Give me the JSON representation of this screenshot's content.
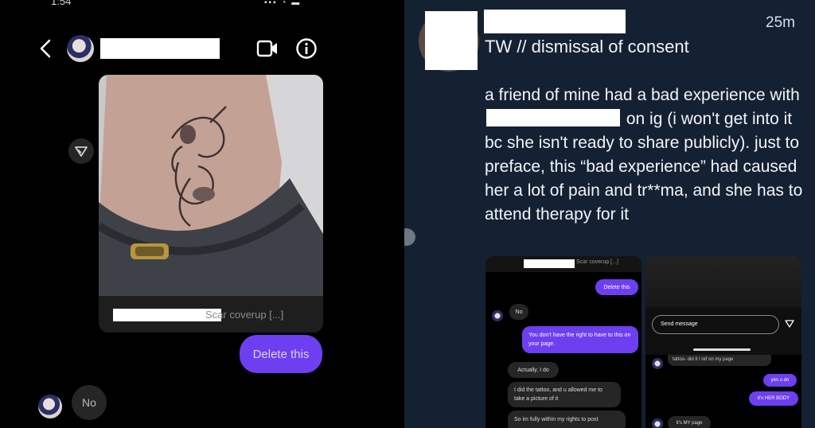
{
  "left_panel": {
    "status_time": "1:54",
    "status_icons": "▪▪▪ ◔ ▬",
    "photo_caption": "Scar coverup [...]",
    "outgoing_message": "Delete this",
    "incoming_message": "No"
  },
  "right_panel": {
    "time_ago": "25m",
    "title": "TW // dismissal of consent",
    "body_before": "a friend of mine had a bad experience with",
    "body_after": "on ig (i won't get into it bc she isn't ready to share publicly). just to preface, this “bad experience” had caused her a lot of pain and tr**ma, and she has to attend therapy for it",
    "screenshot_1": {
      "caption": "Scar coverup [...]",
      "delete": "Delete this",
      "no": "No",
      "right_msg": "You don't have the right to have to this on your page.",
      "actually": "Actually, I do",
      "did_tattoo": "I did the tattoo, and u allowed me to take a picture of it",
      "rights": "So im fully within my rights to post"
    },
    "screenshot_2": {
      "send_placeholder": "Send message",
      "top_msg": "tattoo- did it I ref on my page",
      "yes_u_do": "yes u do",
      "her_body": "it's HER BODY",
      "my_page": "It's MY page"
    }
  },
  "colors": {
    "left_bg": "#000000",
    "right_bg": "#142133",
    "bubble_purple": "#6d3ff0",
    "bubble_gray": "#262626"
  }
}
